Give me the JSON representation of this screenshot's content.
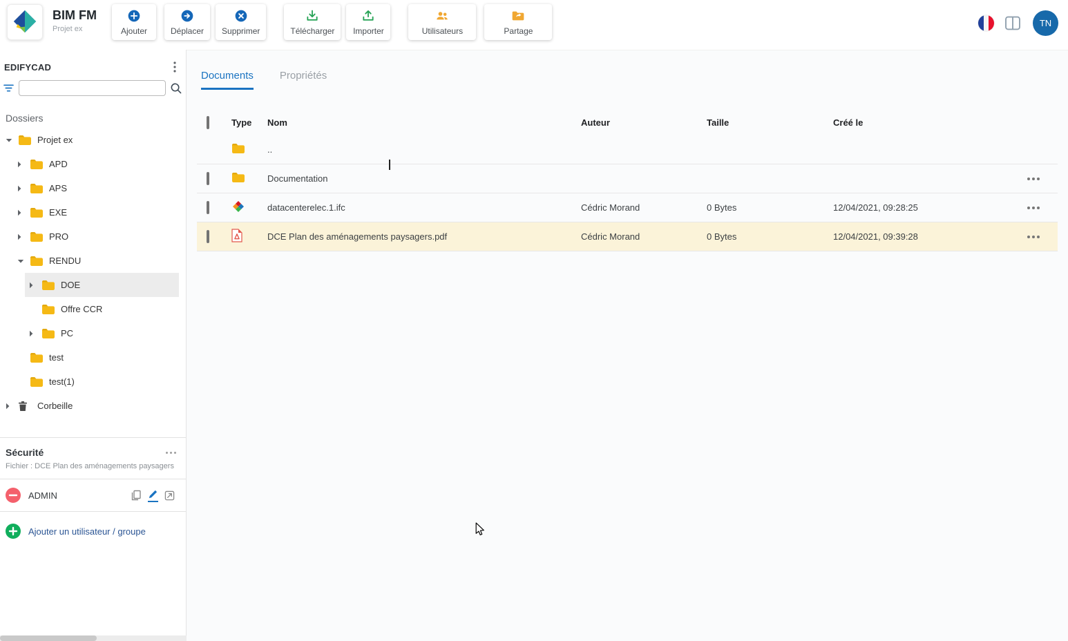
{
  "app": {
    "name": "BIM FM",
    "project": "Projet ex",
    "avatar_initials": "TN"
  },
  "colors": {
    "primary_blue": "#1567b8",
    "tab_active_blue": "#1a73c1",
    "green": "#27a356",
    "orange": "#f0a732",
    "folder_yellow": "#f5b915",
    "selected_row_bg": "#fbf3d9",
    "remove_red": "#f4606c",
    "add_green": "#10ae5c"
  },
  "toolbar": {
    "buttons": [
      {
        "label": "Ajouter",
        "icon": "add-circle-icon"
      },
      {
        "label": "Déplacer",
        "icon": "move-circle-icon"
      },
      {
        "label": "Supprimer",
        "icon": "delete-circle-icon"
      },
      {
        "label": "Télécharger",
        "icon": "download-icon"
      },
      {
        "label": "Importer",
        "icon": "upload-icon"
      },
      {
        "label": "Utilisateurs",
        "icon": "users-icon"
      },
      {
        "label": "Partage",
        "icon": "share-folder-icon"
      }
    ],
    "right_icons": [
      "french-flag-icon",
      "columns-layout-icon",
      "user-avatar"
    ]
  },
  "sidebar": {
    "brand": "EDIFYCAD",
    "search_value": "",
    "folders_heading": "Dossiers",
    "tree": [
      {
        "label": "Projet ex",
        "level": 0,
        "chevron": "down",
        "icon": "folder",
        "selected": false
      },
      {
        "label": "APD",
        "level": 1,
        "chevron": "right",
        "icon": "folder",
        "selected": false
      },
      {
        "label": "APS",
        "level": 1,
        "chevron": "right",
        "icon": "folder",
        "selected": false
      },
      {
        "label": "EXE",
        "level": 1,
        "chevron": "right",
        "icon": "folder",
        "selected": false
      },
      {
        "label": "PRO",
        "level": 1,
        "chevron": "right",
        "icon": "folder",
        "selected": false
      },
      {
        "label": "RENDU",
        "level": 1,
        "chevron": "down",
        "icon": "folder",
        "selected": false
      },
      {
        "label": "DOE",
        "level": 2,
        "chevron": "right",
        "icon": "folder",
        "selected": true
      },
      {
        "label": "Offre CCR",
        "level": 2,
        "chevron": "none",
        "icon": "folder",
        "selected": false
      },
      {
        "label": "PC",
        "level": 2,
        "chevron": "right",
        "icon": "folder",
        "selected": false
      },
      {
        "label": "test",
        "level": 1,
        "chevron": "none",
        "icon": "folder",
        "selected": false
      },
      {
        "label": "test(1)",
        "level": 1,
        "chevron": "none",
        "icon": "folder",
        "selected": false
      },
      {
        "label": "Corbeille",
        "level": 0,
        "chevron": "right",
        "icon": "trash",
        "selected": false
      }
    ],
    "security": {
      "heading": "Sécurité",
      "file_info": "Fichier : DCE Plan des aménagements paysagers",
      "entries": [
        {
          "name": "ADMIN",
          "icons": [
            "copy-icon",
            "edit-pencil-icon",
            "export-icon"
          ]
        }
      ],
      "add_label": "Ajouter un utilisateur / groupe"
    }
  },
  "main": {
    "tabs": [
      {
        "label": "Documents",
        "active": true
      },
      {
        "label": "Propriétés",
        "active": false
      }
    ],
    "table": {
      "headers": {
        "type": "Type",
        "name": "Nom",
        "author": "Auteur",
        "size": "Taille",
        "created": "Créé le"
      },
      "rows": [
        {
          "icon": "folder",
          "name": "..",
          "author": "",
          "size": "",
          "created": ""
        },
        {
          "icon": "folder",
          "name": "Documentation",
          "author": "",
          "size": "",
          "created": ""
        },
        {
          "icon": "ifc-file",
          "name": "datacenterelec.1.ifc",
          "author": "Cédric Morand",
          "size": "0 Bytes",
          "created": "12/04/2021, 09:28:25"
        },
        {
          "icon": "pdf-file",
          "name": "DCE Plan des aménagements paysagers.pdf",
          "author": "Cédric Morand",
          "size": "0 Bytes",
          "created": "12/04/2021, 09:39:28"
        }
      ]
    }
  }
}
